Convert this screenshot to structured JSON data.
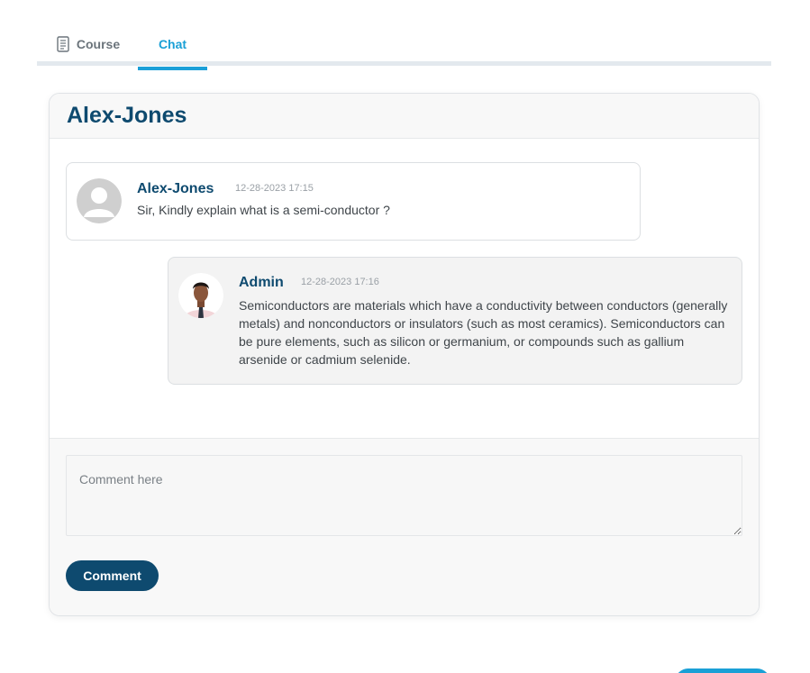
{
  "tabs": [
    {
      "label": "Course",
      "icon": "document-icon",
      "active": false
    },
    {
      "label": "Chat",
      "active": true
    }
  ],
  "chat": {
    "title": "Alex-Jones",
    "messages": [
      {
        "author": "Alex-Jones",
        "timestamp": "12-28-2023 17:15",
        "text": "Sir, Kindly explain what is a semi-conductor ?",
        "avatar": "default-avatar-icon"
      },
      {
        "author": "Admin",
        "timestamp": "12-28-2023 17:16",
        "text": "Semiconductors are materials which have a conductivity between conductors (generally metals) and nonconductors or insulators (such as most ceramics). Semiconductors can be pure elements, such as silicon or germanium, or compounds such as gallium arsenide or cadmium selenide.",
        "avatar": "admin-photo-avatar"
      }
    ]
  },
  "comment": {
    "placeholder": "Comment here",
    "value": "",
    "button_label": "Comment"
  },
  "colors": {
    "primary": "#0e4a6f",
    "accent": "#1aa0d6",
    "tab_inactive": "#6b747b"
  }
}
